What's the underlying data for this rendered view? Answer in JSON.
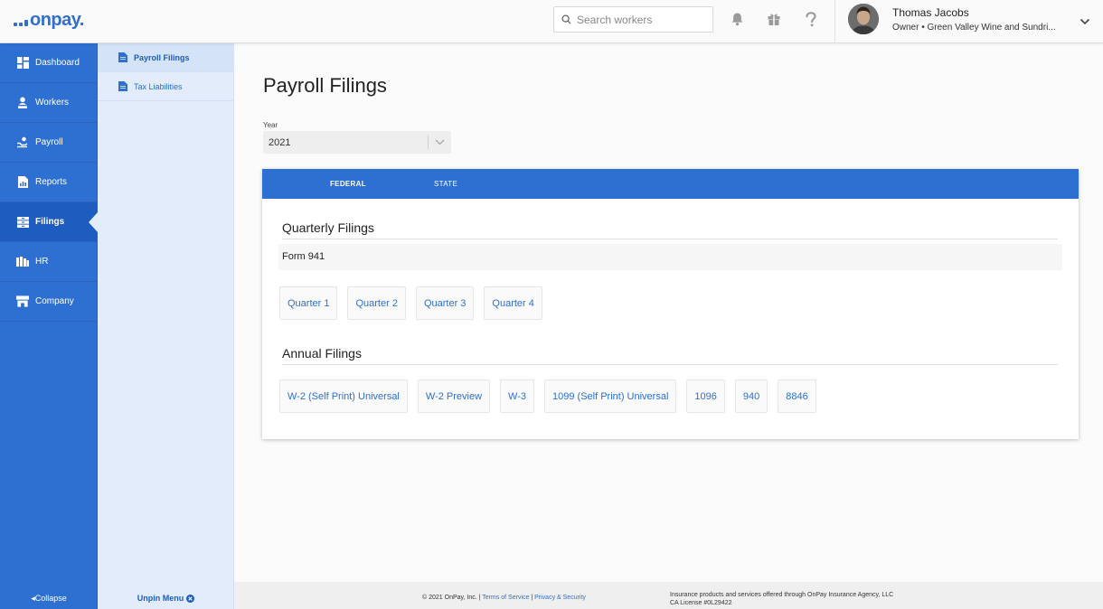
{
  "header": {
    "logo_text": "onpay.",
    "search_placeholder": "Search workers",
    "icons": [
      "bell-icon",
      "gift-icon",
      "help-icon"
    ],
    "user": {
      "name": "Thomas Jacobs",
      "role": "Owner • Green Valley Wine and Sundri..."
    }
  },
  "nav": {
    "items": [
      {
        "label": "Dashboard",
        "icon": "dashboard-icon"
      },
      {
        "label": "Workers",
        "icon": "workers-icon"
      },
      {
        "label": "Payroll",
        "icon": "payroll-icon"
      },
      {
        "label": "Reports",
        "icon": "reports-icon"
      },
      {
        "label": "Filings",
        "icon": "filings-icon",
        "active": true
      },
      {
        "label": "HR",
        "icon": "hr-icon"
      },
      {
        "label": "Company",
        "icon": "company-icon"
      }
    ],
    "collapse_label": "Collapse"
  },
  "subnav": {
    "items": [
      {
        "label": "Payroll Filings",
        "active": true
      },
      {
        "label": "Tax Liabilities"
      }
    ],
    "unpin_label": "Unpin Menu"
  },
  "main": {
    "title": "Payroll Filings",
    "year_label": "Year",
    "year_value": "2021",
    "tabs": [
      {
        "label": "FEDERAL",
        "active": true
      },
      {
        "label": "STATE"
      }
    ],
    "quarterly": {
      "title": "Quarterly Filings",
      "form": "Form 941",
      "buttons": [
        "Quarter 1",
        "Quarter 2",
        "Quarter 3",
        "Quarter 4"
      ]
    },
    "annual": {
      "title": "Annual Filings",
      "buttons": [
        "W-2 (Self Print) Universal",
        "W-2 Preview",
        "W-3",
        "1099 (Self Print) Universal",
        "1096",
        "940",
        "8846"
      ]
    }
  },
  "footer": {
    "copyright": "© 2021 OnPay, Inc. |",
    "terms": "Terms of Service",
    "sep": "|",
    "privacy": "Privacy & Security",
    "insurance_line1": "Insurance products and services offered through OnPay Insurance Agency, LLC",
    "insurance_line2": "CA License #0L29422"
  },
  "colors": {
    "brand": "#2e70d2",
    "link": "#2e6fcf",
    "subnav_bg": "#e2ecfb"
  }
}
